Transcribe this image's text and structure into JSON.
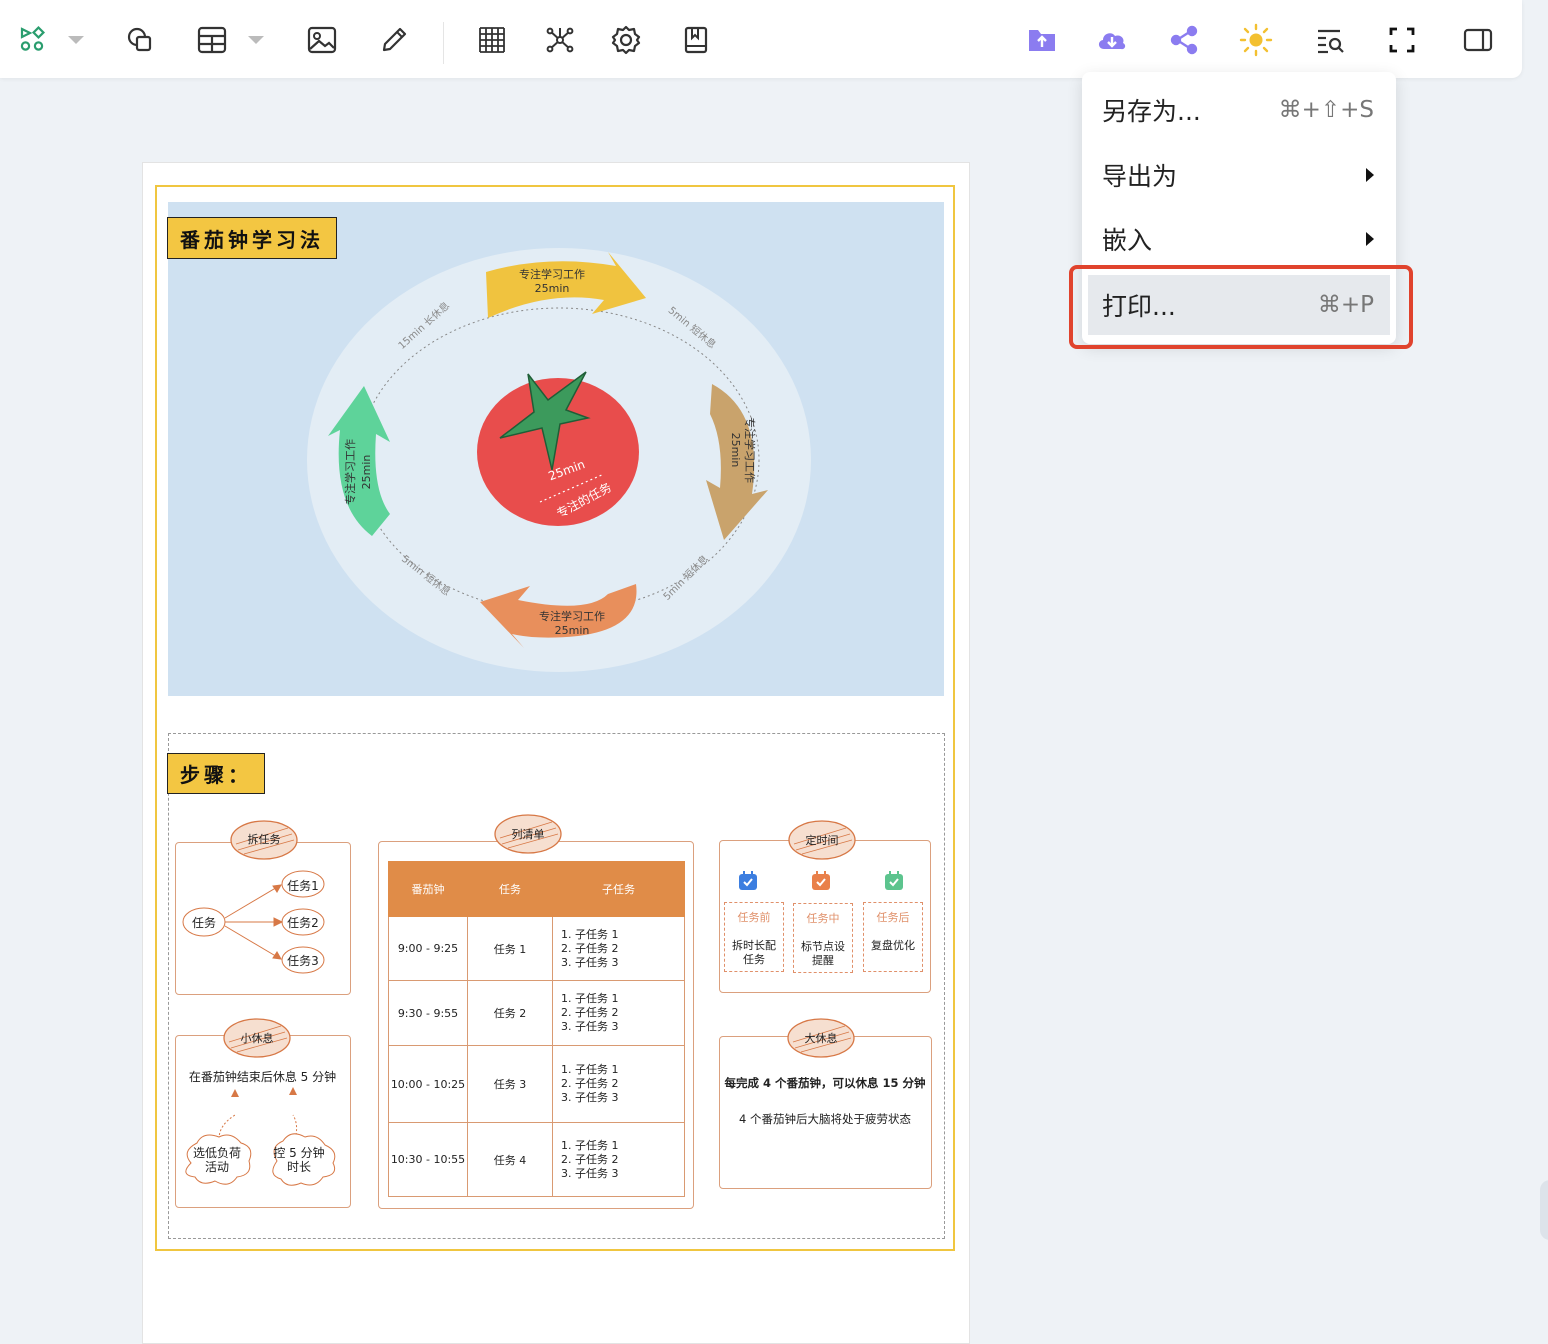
{
  "menu": {
    "save_as": {
      "label": "另存为...",
      "shortcut": "⌘+⇧+S"
    },
    "export_as": {
      "label": "导出为"
    },
    "embed": {
      "label": "嵌入"
    },
    "print": {
      "label": "打印...",
      "shortcut": "⌘+P"
    }
  },
  "diagram": {
    "title": "番茄钟学习法",
    "arrows": {
      "top": {
        "line1": "专注学习工作",
        "line2": "25min"
      },
      "right": {
        "line1": "专注学习工作",
        "line2": "25min"
      },
      "bottom": {
        "line1": "专注学习工作",
        "line2": "25min"
      },
      "left": {
        "line1": "专注学习工作",
        "line2": "25min"
      }
    },
    "breaks": {
      "top_right": "5min 短休息",
      "bottom_right": "5min 短休息",
      "bottom_left": "5min 短休息",
      "top_left": "15min 长休息"
    },
    "tomato": {
      "time": "25min",
      "task": "专注的任务"
    }
  },
  "steps": {
    "title": "步骤：",
    "split": {
      "badge": "拆任务",
      "root": "任务",
      "children": [
        "任务1",
        "任务2",
        "任务3"
      ]
    },
    "list": {
      "badge": "列清单",
      "headers": [
        "番茄钟",
        "任务",
        "子任务"
      ],
      "rows": [
        {
          "time": "9:00 - 9:25",
          "task": "任务 1",
          "subs": [
            "1. 子任务 1",
            "2. 子任务 2",
            "3. 子任务 3"
          ]
        },
        {
          "time": "9:30 - 9:55",
          "task": "任务 2",
          "subs": [
            "1. 子任务 1",
            "2. 子任务 2",
            "3. 子任务 3"
          ]
        },
        {
          "time": "10:00 - 10:25",
          "task": "任务 3",
          "subs": [
            "1. 子任务 1",
            "2. 子任务 2",
            "3. 子任务 3"
          ]
        },
        {
          "time": "10:30 - 10:55",
          "task": "任务 4",
          "subs": [
            "1. 子任务 1",
            "2. 子任务 2",
            "3. 子任务 3"
          ]
        }
      ]
    },
    "time": {
      "badge": "定时间",
      "stages": [
        {
          "title": "任务前",
          "desc1": "拆时长配",
          "desc2": "任务",
          "color": "#3c7ee0"
        },
        {
          "title": "任务中",
          "desc1": "标节点设",
          "desc2": "提醒",
          "color": "#e9804a"
        },
        {
          "title": "任务后",
          "desc1": "复盘优化",
          "desc2": "",
          "color": "#5cc48e"
        }
      ]
    },
    "short_break": {
      "badge": "小休息",
      "text": "在番茄钟结束后休息 5 分钟",
      "cloud1_l1": "选低负荷",
      "cloud1_l2": "活动",
      "cloud2_l1": "控 5 分钟",
      "cloud2_l2": "时长"
    },
    "long_break": {
      "badge": "大休息",
      "text1": "每完成 4 个番茄钟，可以休息 15 分钟",
      "text2": "4 个番茄钟后大脑将处于疲劳状态"
    }
  }
}
